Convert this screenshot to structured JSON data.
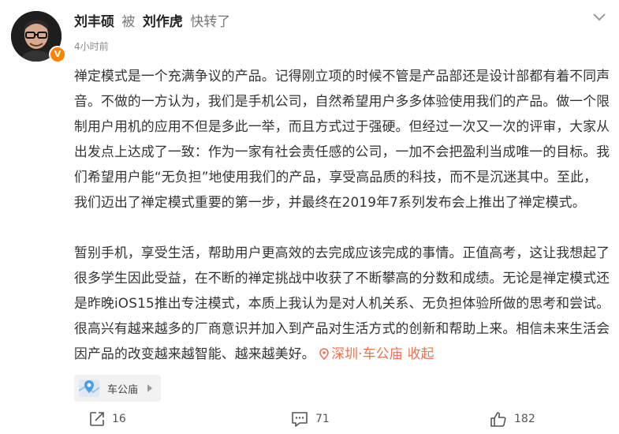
{
  "post": {
    "author": "刘丰硕",
    "by": "被",
    "reposter": "刘作虎",
    "repost_label": "快转了",
    "time": "4小时前",
    "paragraph1": "禅定模式是一个充满争议的产品。记得刚立项的时候不管是产品部还是设计部都有着不同声音。不做的一方认为，我们是手机公司，自然希望用户多多体验使用我们的产品。做一个限制用户用机的应用不但是多此一举，而且方式过于强硬。但经过一次又一次的评审，大家从出发点上达成了一致：作为一家有社会责任感的公司，一加不会把盈利当成唯一的目标。我们希望用户能“无负担”地使用我们的产品，享受高品质的科技，而不是沉迷其中。至此，我们迈出了禅定模式重要的第一步，并最终在2019年7系列发布会上推出了禅定模式。",
    "paragraph2": "暂别手机，享受生活，帮助用户更高效的去完成应该完成的事情。正值高考，这让我想起了很多学生因此受益，在不断的禅定挑战中收获了不断攀高的分数和成绩。无论是禅定模式还是昨晚iOS15推出专注模式，本质上我认为是对人机关系、无负担体验所做的思考和尝试。很高兴有越来越多的厂商意识并加入到产品对生活方式的创新和帮助上来。相信未来生活会因产品的改变越来越智能、越来越美好。",
    "location_inline": "深圳·车公庙",
    "collapse_label": "收起",
    "location_chip": "车公庙"
  },
  "actions": {
    "reposts": "16",
    "comments": "71",
    "likes": "182"
  },
  "colors": {
    "accent": "#eb7350",
    "verified": "#ff8200"
  }
}
